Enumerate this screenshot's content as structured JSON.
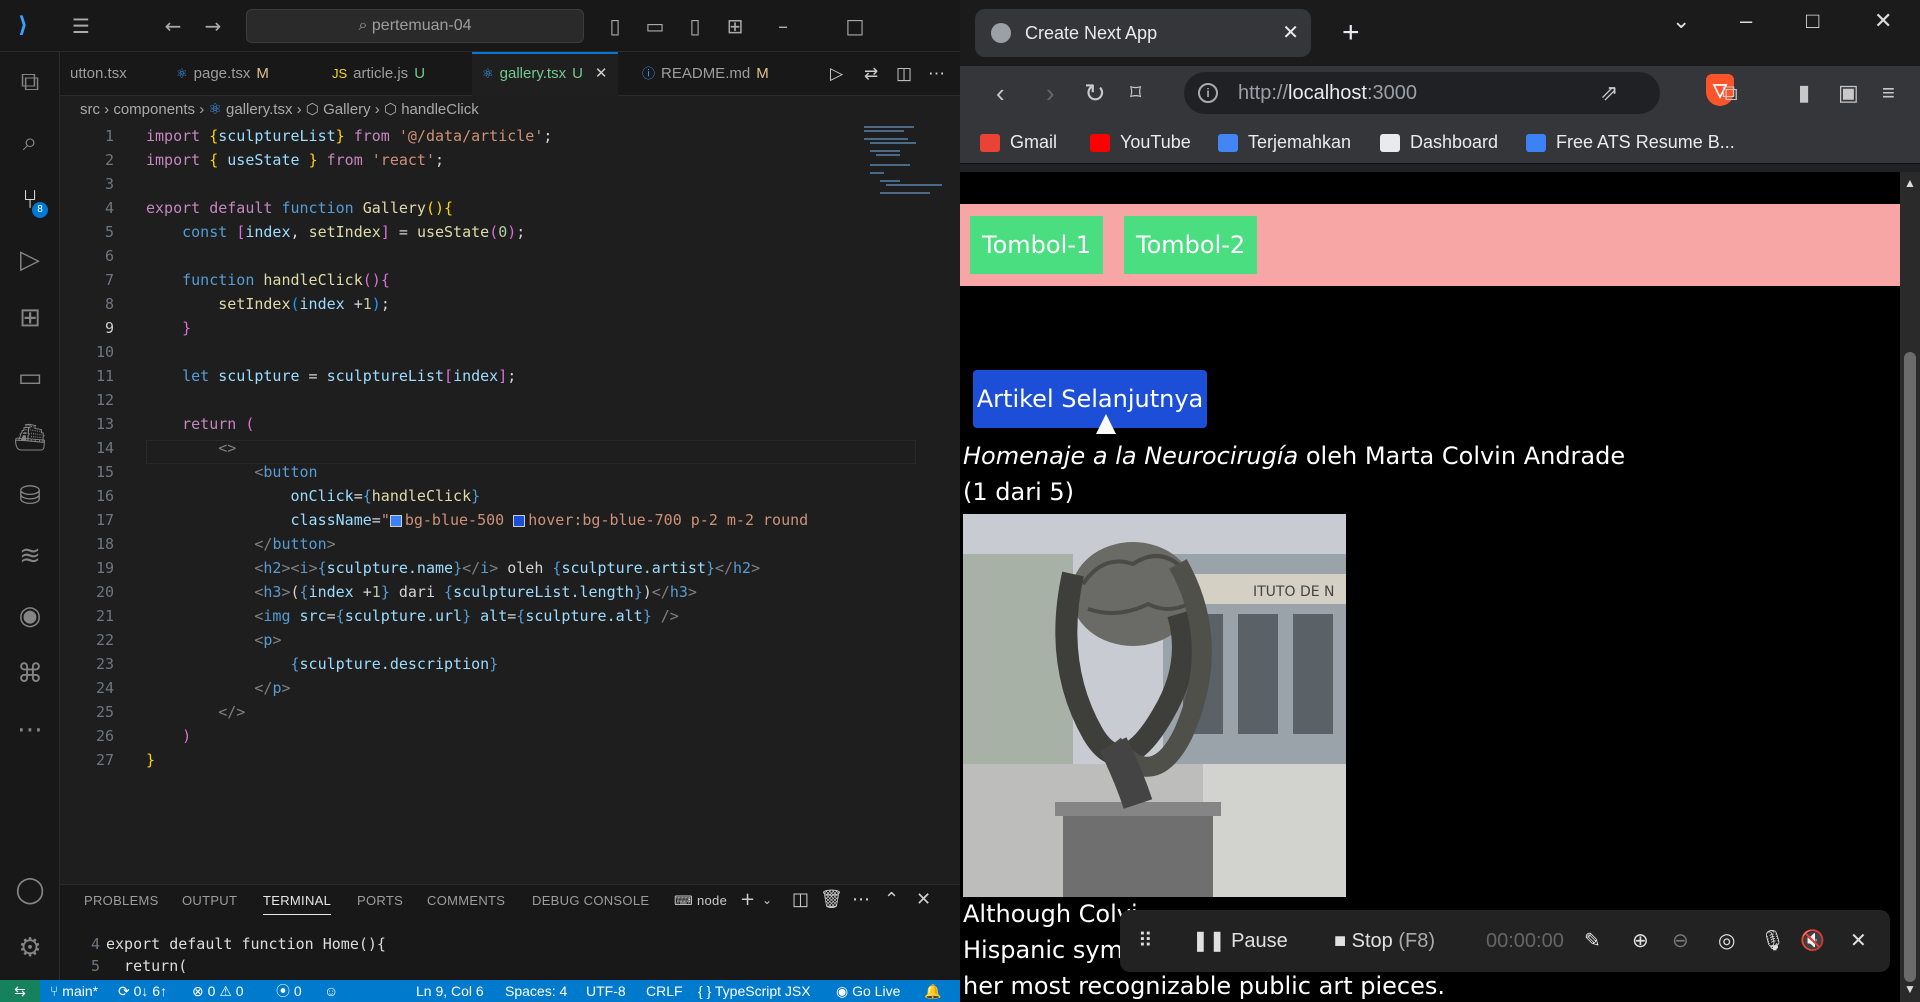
{
  "vscode": {
    "search": "pertemuan-04",
    "tabs": [
      {
        "name": "utton.tsx",
        "status": ""
      },
      {
        "name": "page.tsx",
        "status": "M"
      },
      {
        "name": "article.js",
        "status": "U"
      },
      {
        "name": "gallery.tsx",
        "status": "U"
      },
      {
        "name": "README.md",
        "status": "M"
      }
    ],
    "breadcrumb": [
      "src",
      "components",
      "gallery.tsx",
      "Gallery",
      "handleClick"
    ],
    "scm_badge": "8",
    "panel_tabs": [
      "PROBLEMS",
      "OUTPUT",
      "TERMINAL",
      "PORTS",
      "COMMENTS",
      "DEBUG CONSOLE"
    ],
    "terminal_shell": "node",
    "terminal_lines": [
      {
        "num": "4",
        "text": "export default function Home(){"
      },
      {
        "num": "5",
        "text": "  return("
      }
    ],
    "status": {
      "branch": "main*",
      "sync": "0↓ 6↑",
      "errors": "0",
      "warnings": "0",
      "ports": "0",
      "position": "Ln 9, Col 6",
      "spaces": "Spaces: 4",
      "encoding": "UTF-8",
      "eol": "CRLF",
      "language": "TypeScript JSX",
      "golive": "Go Live"
    },
    "code_lines": [
      "1",
      "2",
      "3",
      "4",
      "5",
      "6",
      "7",
      "8",
      "9",
      "10",
      "11",
      "12",
      "13",
      "14",
      "15",
      "16",
      "17",
      "18",
      "19",
      "20",
      "21",
      "22",
      "23",
      "24",
      "25",
      "26",
      "27"
    ]
  },
  "browser": {
    "tab_title": "Create Next App",
    "url_prefix": "http://",
    "url_host": "localhost",
    "url_port": ":3000",
    "bookmarks": [
      {
        "label": "Gmail",
        "color": "#ea4335"
      },
      {
        "label": "YouTube",
        "color": "#ff0000"
      },
      {
        "label": "Terjemahkan",
        "color": "#4285f4"
      },
      {
        "label": "Dashboard",
        "color": "#e8eaed"
      },
      {
        "label": "Free ATS Resume B...",
        "color": "#3b82f6"
      }
    ],
    "page": {
      "buttons": [
        "Tombol-1",
        "Tombol-2"
      ],
      "next_button": "Artikel Selanjutnya",
      "sculpture_name": "Homenaje a la Neurocirugía",
      "by": "oleh",
      "artist": "Marta Colvin Andrade",
      "counter": "(1 dari 5)",
      "description_visible": [
        "Although Colvi",
        "Hispanic symb",
        "her most recognizable public art pieces."
      ],
      "plaque_text": "ITUTO DE N"
    },
    "recorder": {
      "pause": "Pause",
      "stop": "Stop",
      "stop_key": "(F8)",
      "time": "00:00:00"
    },
    "colors": {
      "pink": "#f8a5a5",
      "green": "#4ade80",
      "blue": "#1d4ed8"
    }
  }
}
